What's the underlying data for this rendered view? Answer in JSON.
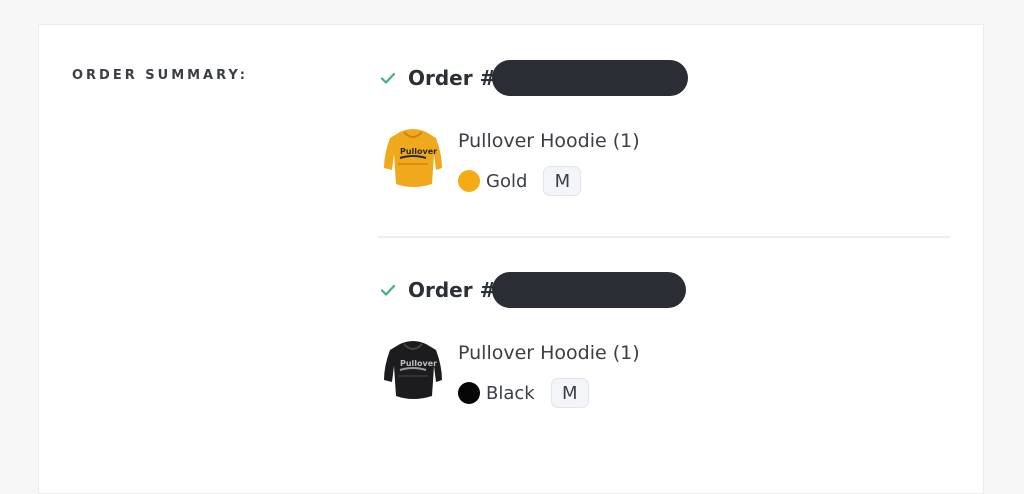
{
  "summary_label": "ORDER SUMMARY:",
  "colors": {
    "check": "#3db37a",
    "gold": "#f4ab14",
    "black": "#050505"
  },
  "orders": [
    {
      "title": "Order #",
      "status_icon": "check-icon",
      "item": {
        "name": "Pullover Hoodie (1)",
        "color_name": "Gold",
        "size": "M",
        "thumbnail": "gold-hoodie-image"
      }
    },
    {
      "title": "Order #",
      "status_icon": "check-icon",
      "item": {
        "name": "Pullover Hoodie (1)",
        "color_name": "Black",
        "size": "M",
        "thumbnail": "black-hoodie-image"
      }
    }
  ]
}
